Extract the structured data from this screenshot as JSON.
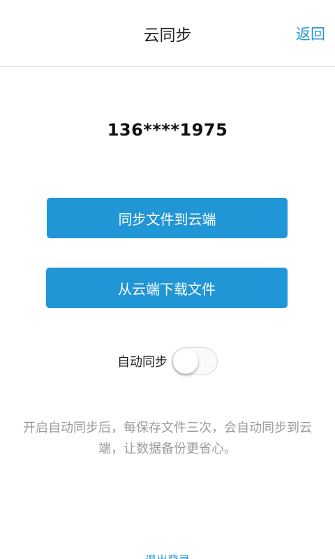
{
  "header": {
    "title": "云同步",
    "back_label": "返回"
  },
  "account": {
    "phone_masked": "136****1975"
  },
  "actions": {
    "upload_label": "同步文件到云端",
    "download_label": "从云端下载文件"
  },
  "auto_sync": {
    "label": "自动同步",
    "enabled": false
  },
  "hint": {
    "text": "开启自动同步后，每保存文件三次，会自动同步到云端，让数据备份更省心。"
  },
  "footer": {
    "logout_label": "退出登录"
  },
  "colors": {
    "accent": "#2196d6",
    "hint_text": "#9a9a9a"
  }
}
